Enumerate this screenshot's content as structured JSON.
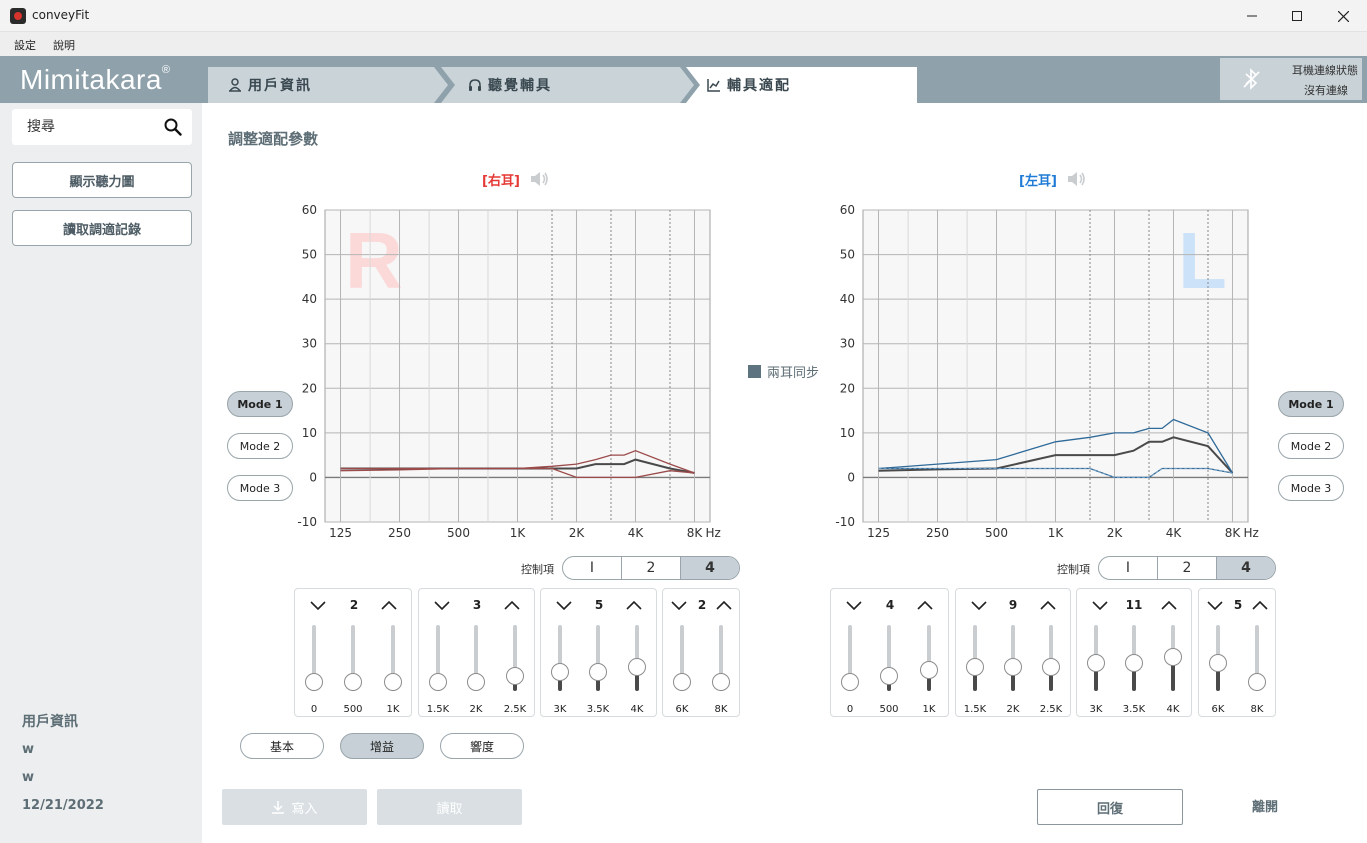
{
  "window": {
    "title": "conveyFit"
  },
  "menu": [
    "設定",
    "說明"
  ],
  "brand": {
    "name": "Mimitakara",
    "mark": "®"
  },
  "tabs": [
    {
      "label": "用戶資訊",
      "icon": "user-icon"
    },
    {
      "label": "聽覺輔具",
      "icon": "headphones-icon"
    },
    {
      "label": "輔具適配",
      "icon": "chart-icon",
      "active": true
    }
  ],
  "connection": {
    "title": "耳機連線狀態",
    "status": "沒有連線",
    "icon": "bluetooth-off-icon"
  },
  "sidebar": {
    "search_placeholder": "搜尋",
    "buttons": [
      "顯示聽力圖",
      "讀取調適記錄"
    ],
    "user": {
      "title": "用戶資訊",
      "line1": "w",
      "line2": "w",
      "date": "12/21/2022"
    }
  },
  "main": {
    "title": "調整適配參數",
    "sync_label": "兩耳同步",
    "control_label": "控制項",
    "control_options": [
      "I",
      "2",
      "4"
    ],
    "control_selected": 2,
    "modes": [
      "Mode 1",
      "Mode 2",
      "Mode 3"
    ],
    "mode_selected": 0,
    "pills": [
      "基本",
      "增益",
      "響度"
    ],
    "pill_selected": 1,
    "write_label": "寫入",
    "read_label": "讀取",
    "reset_label": "回復",
    "exit_label": "離開"
  },
  "colors": {
    "right": "#e53935",
    "left": "#1f7bd6",
    "accent": "#c6d0d6",
    "right_watermark": "#fbd9d9",
    "left_watermark": "#cce2f8",
    "right_line": "#9c4a4a",
    "left_line": "#2f6a99"
  },
  "chart_data": [
    {
      "type": "line",
      "title": "[右耳]",
      "watermark": "R",
      "xlabel": "Hz",
      "x": [
        "125",
        "250",
        "500",
        "1K",
        "2K",
        "4K",
        "8K"
      ],
      "ylim": [
        -10,
        60
      ],
      "yticks": [
        -10,
        0,
        10,
        20,
        30,
        40,
        50,
        60
      ],
      "grid": true,
      "series": [
        {
          "points": [
            [
              125,
              2
            ],
            [
              250,
              2
            ],
            [
              500,
              2
            ],
            [
              1000,
              2
            ],
            [
              1500,
              2
            ],
            [
              2000,
              2
            ],
            [
              2500,
              3
            ],
            [
              3000,
              3
            ],
            [
              3500,
              3
            ],
            [
              4000,
              4
            ],
            [
              6000,
              2
            ],
            [
              8000,
              1
            ]
          ]
        },
        {
          "points": [
            [
              125,
              1.5
            ],
            [
              250,
              1.7
            ],
            [
              500,
              2
            ],
            [
              1000,
              2
            ],
            [
              1500,
              2.5
            ],
            [
              2000,
              3
            ],
            [
              2500,
              4
            ],
            [
              3000,
              5
            ],
            [
              3500,
              5
            ],
            [
              4000,
              6
            ],
            [
              6000,
              3
            ],
            [
              8000,
              1
            ]
          ]
        },
        {
          "points": [
            [
              125,
              2
            ],
            [
              250,
              2
            ],
            [
              500,
              2
            ],
            [
              1000,
              2
            ],
            [
              1500,
              2
            ],
            [
              2000,
              0
            ],
            [
              2500,
              0
            ],
            [
              3000,
              0
            ],
            [
              3500,
              0
            ],
            [
              4000,
              0
            ],
            [
              6000,
              1.5
            ],
            [
              8000,
              1
            ]
          ]
        }
      ],
      "controls": {
        "groups": [
          {
            "value": "2",
            "sliders": [
              {
                "label": "0",
                "level": 0
              },
              {
                "label": "500",
                "level": 0
              },
              {
                "label": "1K",
                "level": 0
              }
            ]
          },
          {
            "value": "3",
            "sliders": [
              {
                "label": "1.5K",
                "level": 0
              },
              {
                "label": "2K",
                "level": 0
              },
              {
                "label": "2.5K",
                "level": 0.03
              }
            ]
          },
          {
            "value": "5",
            "sliders": [
              {
                "label": "3K",
                "level": 0.05
              },
              {
                "label": "3.5K",
                "level": 0.05
              },
              {
                "label": "4K",
                "level": 0.08
              }
            ]
          },
          {
            "value": "2",
            "sliders": [
              {
                "label": "6K",
                "level": 0
              },
              {
                "label": "8K",
                "level": 0
              }
            ]
          }
        ]
      }
    },
    {
      "type": "line",
      "title": "[左耳]",
      "watermark": "L",
      "xlabel": "Hz",
      "x": [
        "125",
        "250",
        "500",
        "1K",
        "2K",
        "4K",
        "8K"
      ],
      "ylim": [
        -10,
        60
      ],
      "yticks": [
        -10,
        0,
        10,
        20,
        30,
        40,
        50,
        60
      ],
      "grid": true,
      "series": [
        {
          "points": [
            [
              125,
              1.5
            ],
            [
              250,
              1.8
            ],
            [
              500,
              2
            ],
            [
              1000,
              5
            ],
            [
              1500,
              5
            ],
            [
              2000,
              5
            ],
            [
              2500,
              6
            ],
            [
              3000,
              8
            ],
            [
              3500,
              8
            ],
            [
              4000,
              9
            ],
            [
              6000,
              7
            ],
            [
              8000,
              1
            ]
          ]
        },
        {
          "points": [
            [
              125,
              2
            ],
            [
              250,
              3
            ],
            [
              500,
              4
            ],
            [
              1000,
              8
            ],
            [
              1500,
              9
            ],
            [
              2000,
              10
            ],
            [
              2500,
              10
            ],
            [
              3000,
              11
            ],
            [
              3500,
              11
            ],
            [
              4000,
              13
            ],
            [
              6000,
              10
            ],
            [
              8000,
              1
            ]
          ]
        },
        {
          "points": [
            [
              125,
              2
            ],
            [
              250,
              2
            ],
            [
              500,
              2
            ],
            [
              1000,
              2
            ],
            [
              1500,
              2
            ],
            [
              2000,
              0
            ],
            [
              2500,
              0
            ],
            [
              3000,
              0
            ],
            [
              3500,
              2
            ],
            [
              4000,
              2
            ],
            [
              6000,
              2
            ],
            [
              8000,
              1
            ]
          ]
        }
      ],
      "controls": {
        "groups": [
          {
            "value": "4",
            "sliders": [
              {
                "label": "0",
                "level": 0
              },
              {
                "label": "500",
                "level": 0.03
              },
              {
                "label": "1K",
                "level": 0.06
              }
            ]
          },
          {
            "value": "9",
            "sliders": [
              {
                "label": "1.5K",
                "level": 0.08
              },
              {
                "label": "2K",
                "level": 0.08
              },
              {
                "label": "2.5K",
                "level": 0.08
              }
            ]
          },
          {
            "value": "11",
            "sliders": [
              {
                "label": "3K",
                "level": 0.1
              },
              {
                "label": "3.5K",
                "level": 0.1
              },
              {
                "label": "4K",
                "level": 0.13
              }
            ]
          },
          {
            "value": "5",
            "sliders": [
              {
                "label": "6K",
                "level": 0.1
              },
              {
                "label": "8K",
                "level": 0
              }
            ]
          }
        ]
      }
    }
  ]
}
